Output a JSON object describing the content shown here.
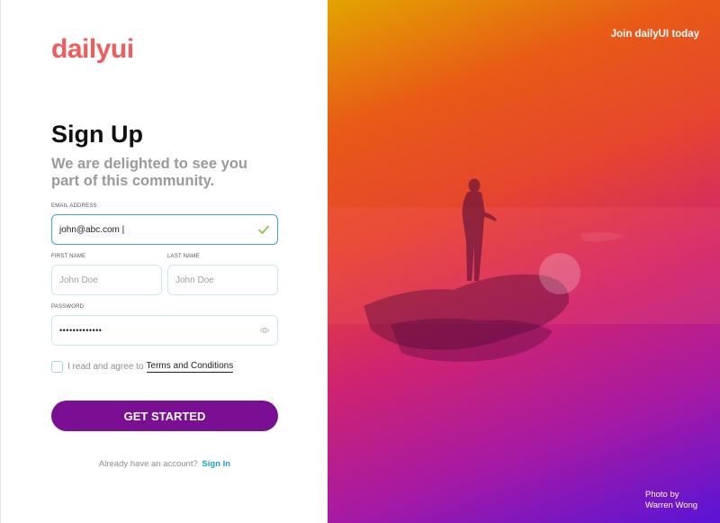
{
  "brand": {
    "logo": "dailyui",
    "logo_color": "#f25c5c"
  },
  "form": {
    "title": "Sign Up",
    "subtitle": "We are delighted to see you part of this community.",
    "email": {
      "label": "EMAIL ADDRESS",
      "value": "john@abc.com |",
      "valid_icon": "check-icon"
    },
    "first_name": {
      "label": "FIRST NAME",
      "placeholder": "John Doe"
    },
    "last_name": {
      "label": "LAST  NAME",
      "placeholder": "John Doe"
    },
    "password": {
      "label": "PASSWORD",
      "value": "•••••••••••••",
      "toggle_icon": "eye-icon"
    },
    "terms": {
      "prefix": "I read and agree to",
      "link": "Terms and Conditions",
      "checked": false
    },
    "submit_label": "GET STARTED",
    "signin_prompt": "Already have an account?",
    "signin_link": "Sign In"
  },
  "hero": {
    "tagline": "Join dailyUI today",
    "credit_line1": "Photo by",
    "credit_line2": "Warren Wong"
  },
  "colors": {
    "accent": "#7a0f93",
    "link": "#1ea0d8",
    "focus_border": "#3aa7d8",
    "valid": "#8cc63f"
  }
}
